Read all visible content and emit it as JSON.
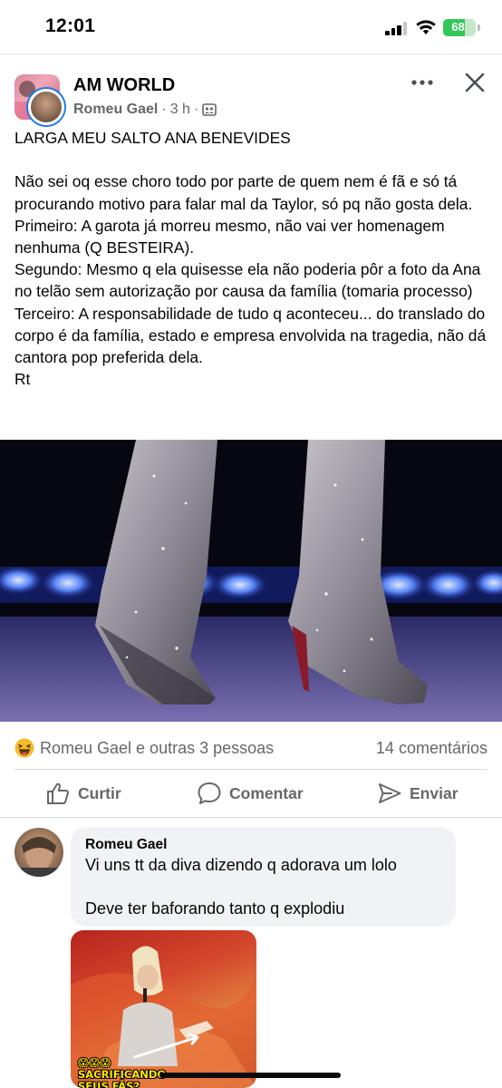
{
  "status_bar": {
    "time": "12:01",
    "battery": "68",
    "battery_level": 0.68,
    "icons": [
      "signal-icon",
      "wifi-icon",
      "battery-icon"
    ]
  },
  "post": {
    "group_name": "AM WORLD",
    "author": "Romeu Gael",
    "time": "3 h",
    "separator": "·",
    "privacy_icon": "group-icon",
    "text": "LARGA MEU SALTO ANA BENEVIDES\n\nNão sei oq esse choro todo por parte de quem nem é fã e só tá procurando motivo para falar mal da Taylor, só pq não gosta dela.\nPrimeiro: A garota já morreu mesmo, não vai ver homenagem nenhuma (Q BESTEIRA).\nSegundo: Mesmo q ela quisesse ela não poderia pôr a foto da Ana no telão sem autorização por causa da família (tomaria processo)\nTerceiro: A responsabilidade de tudo q aconteceu... do translado do corpo é da família, estado e empresa envolvida na tragedia, não dá cantora pop preferida dela.\nRt"
  },
  "reactions": {
    "summary": "Romeu Gael e outras 3 pessoas",
    "comments": "14 comentários",
    "reaction_icon": "haha-icon"
  },
  "actions": {
    "like": "Curtir",
    "comment": "Comentar",
    "send": "Enviar"
  },
  "comment": {
    "author": "Romeu Gael",
    "text": "Vi uns tt da diva dizendo q adorava um lolo\n\nDeve ter baforando tanto q explodiu",
    "image_caption": "😱😱😱 SACRIFICANDO SEUS FÃS? ENTENDA!"
  },
  "colors": {
    "accent": "#1877f2",
    "secondary_text": "#65676b",
    "bubble": "#f0f2f5",
    "battery_green": "#34c759"
  }
}
